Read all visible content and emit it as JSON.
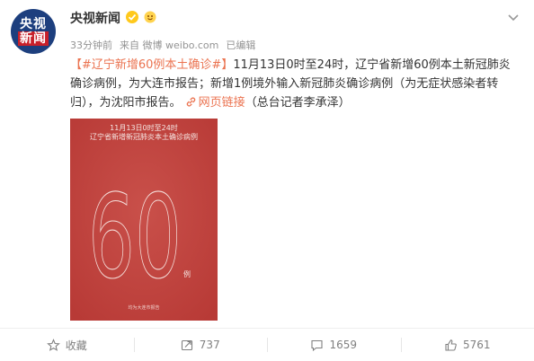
{
  "avatar": {
    "line1": "央视",
    "line2": "新闻"
  },
  "user": {
    "name": "央视新闻"
  },
  "meta": {
    "time": "33分钟前",
    "source": "来自 微博 weibo.com",
    "edited": "已编辑"
  },
  "post": {
    "hashtag": "【#辽宁新增60例本土确诊#】",
    "body": "11月13日0时至24时，辽宁省新增60例本土新冠肺炎确诊病例，为大连市报告；新增1例境外输入新冠肺炎确诊病例（为无症状感染者转归），为沈阳市报告。",
    "link_label": "网页链接",
    "credit": "（总台记者李承泽）"
  },
  "poster": {
    "headline1": "11月13日0时至24时",
    "headline2": "辽宁省新增新冠肺炎本土确诊病例",
    "number": "60",
    "unit": "例",
    "footer": "均为大连市报告",
    "background_color": "#c4463f"
  },
  "actions": {
    "favorite_label": "收藏",
    "repost_count": "737",
    "comment_count": "1659",
    "like_count": "5761"
  },
  "colors": {
    "accent": "#eb7350",
    "verified": "#ffc91c"
  }
}
